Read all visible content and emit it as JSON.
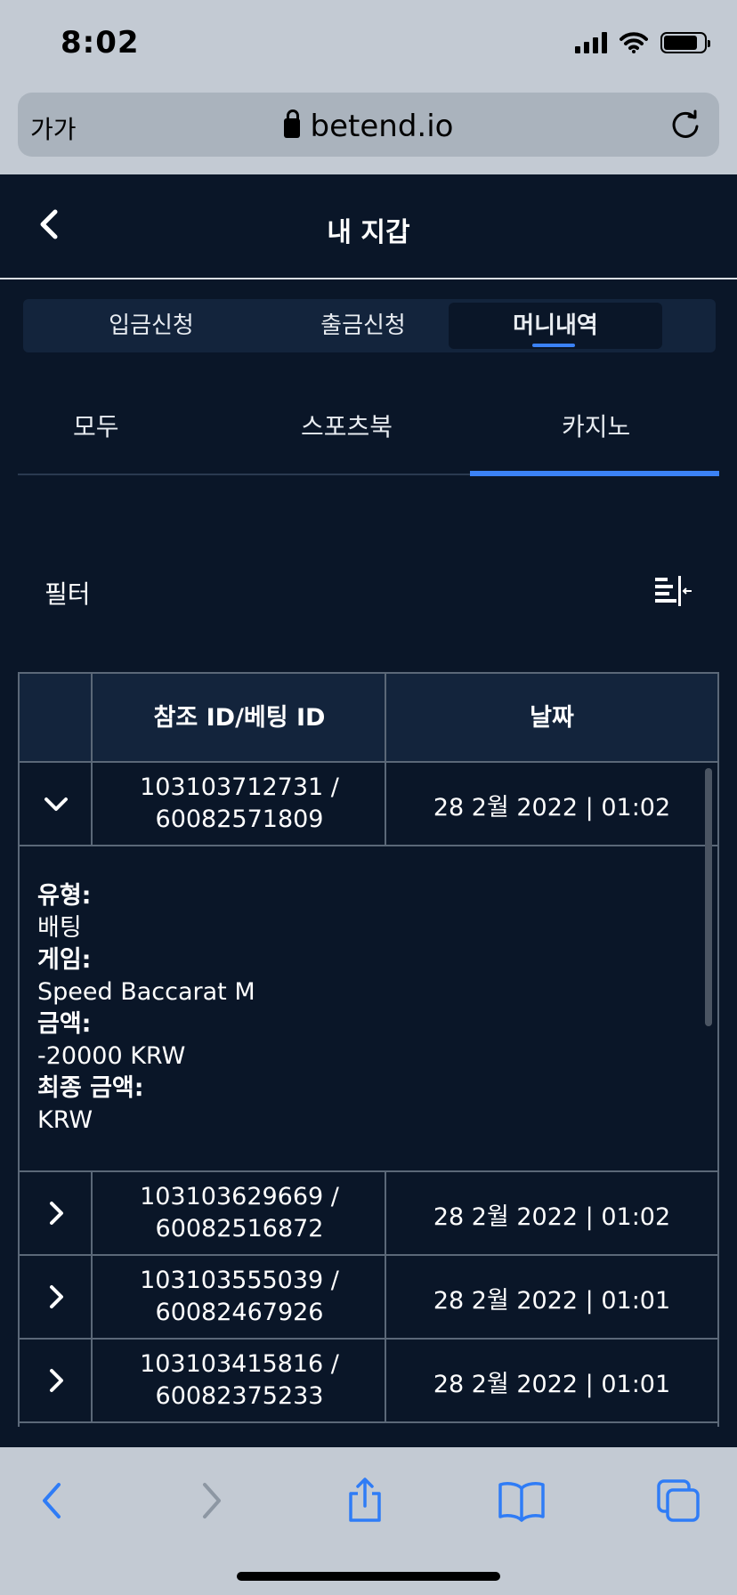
{
  "status_bar": {
    "time": "8:02"
  },
  "browser": {
    "text_size_label": "가가",
    "url": "betend.io"
  },
  "header": {
    "title": "내 지갑"
  },
  "wallet_tabs": [
    {
      "label": "입금신청"
    },
    {
      "label": "출금신청"
    },
    {
      "label": "머니내역"
    }
  ],
  "sub_tabs": [
    {
      "label": "모두"
    },
    {
      "label": "스포츠북"
    },
    {
      "label": "카지노"
    }
  ],
  "filter": {
    "label": "필터"
  },
  "table": {
    "columns": [
      "",
      "참조 ID/베팅 ID",
      "날짜"
    ],
    "rows": [
      {
        "ref_line1": "103103712731 /",
        "ref_line2": "60082571809",
        "date": "28 2월 2022 | 01:02"
      },
      {
        "ref_line1": "103103629669 /",
        "ref_line2": "60082516872",
        "date": "28 2월 2022 | 01:02"
      },
      {
        "ref_line1": "103103555039 /",
        "ref_line2": "60082467926",
        "date": "28 2월 2022 | 01:01"
      },
      {
        "ref_line1": "103103415816 /",
        "ref_line2": "60082375233",
        "date": "28 2월 2022 | 01:01"
      }
    ],
    "expanded_details": {
      "type_label": "유형:",
      "type_value": "배팅",
      "game_label": "게임:",
      "game_value": "Speed Baccarat M",
      "amount_label": "금액:",
      "amount_value": "-20000 KRW",
      "final_label": "최종 금액:",
      "final_value": "KRW"
    }
  },
  "colors": {
    "background": "#0a1628",
    "accent": "#3b82f6",
    "panel": "#13243c",
    "browser_chrome": "#c3cad3"
  }
}
